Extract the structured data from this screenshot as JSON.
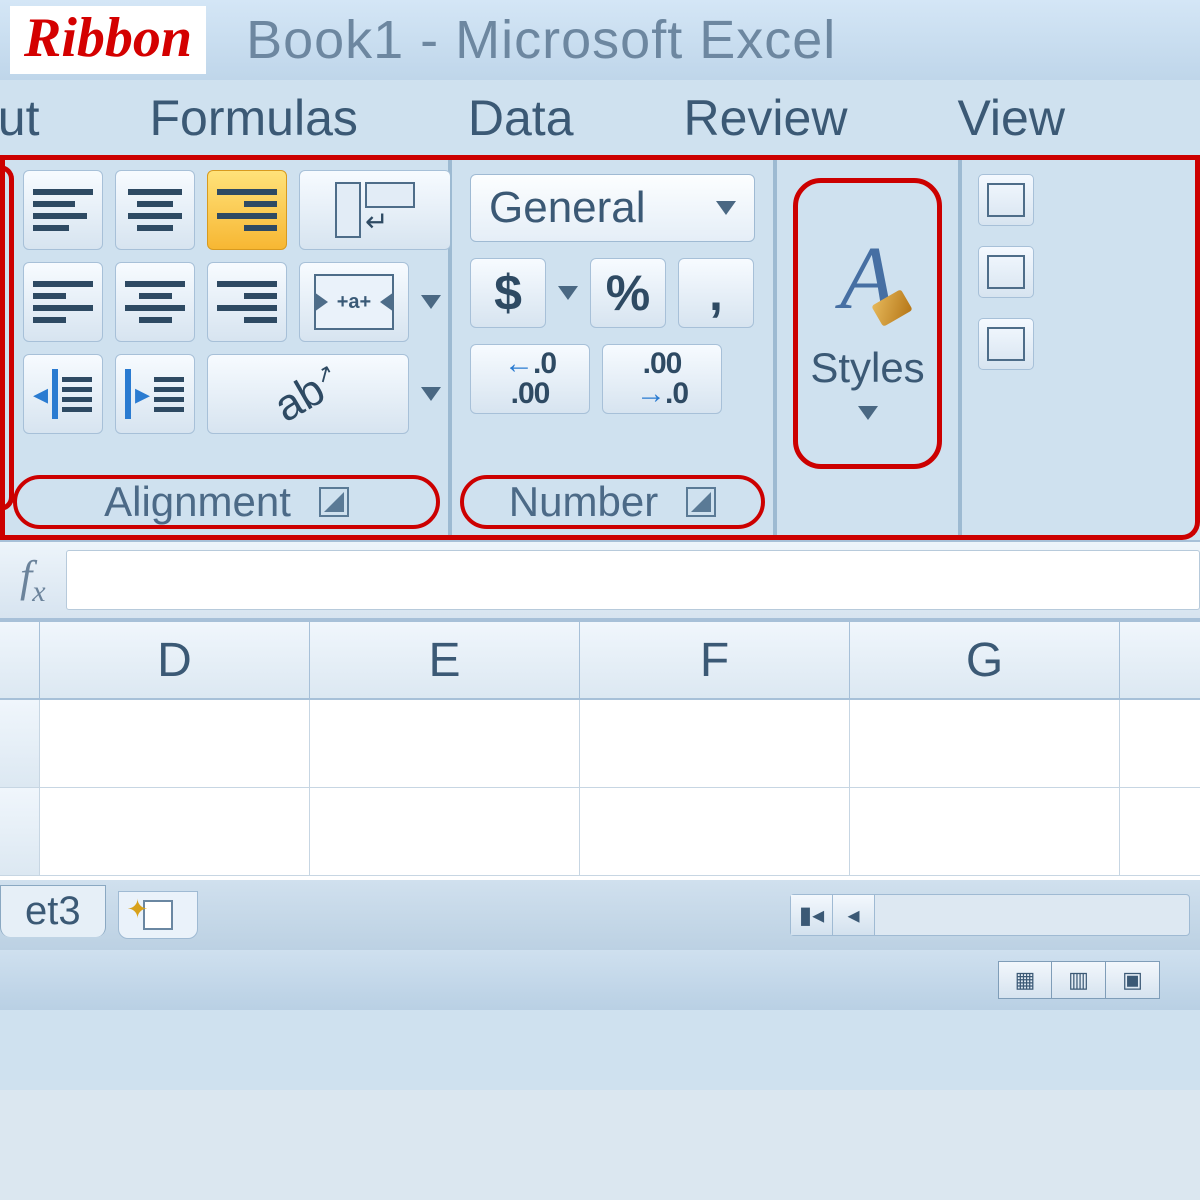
{
  "annotation": {
    "ribbon": "Ribbon"
  },
  "window": {
    "title": "Book1 - Microsoft Excel"
  },
  "tabs": [
    "out",
    "Formulas",
    "Data",
    "Review",
    "View"
  ],
  "ribbon_groups": {
    "alignment": {
      "label": "Alignment"
    },
    "number": {
      "label": "Number",
      "format": "General",
      "currency": "$",
      "percent": "%",
      "comma": ",",
      "inc_dec": "←.0\n.00",
      "dec_dec": ".00\n→.0"
    },
    "styles": {
      "label": "Styles",
      "icon_letter": "A"
    }
  },
  "formula_bar": {
    "fx": "fx"
  },
  "columns": [
    "D",
    "E",
    "F",
    "G"
  ],
  "sheet_tabs": {
    "visible": "et3"
  }
}
